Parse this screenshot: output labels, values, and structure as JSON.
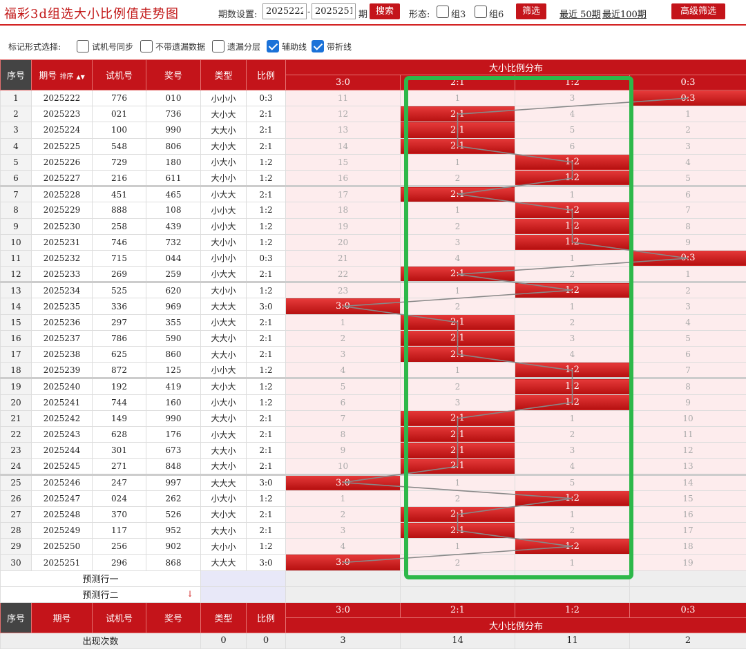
{
  "toolbar": {
    "title": "福彩3d组选大小比例值走势图",
    "period_label": "期数设置:",
    "from": "2025222",
    "dash": "-",
    "to": "2025251",
    "period_unit": "期",
    "search": "搜索",
    "form_label": "形态:",
    "zu3": "组3",
    "zu6": "组6",
    "filter": "筛选",
    "recent50": "最近 50期",
    "recent100": "最近100期",
    "advanced": "高级筛选"
  },
  "options": {
    "label": "标记形式选择:",
    "items": [
      {
        "label": "试机号同步",
        "checked": false
      },
      {
        "label": "不带遗漏数据",
        "checked": false
      },
      {
        "label": "遗漏分层",
        "checked": false
      },
      {
        "label": "辅助线",
        "checked": true
      },
      {
        "label": "带折线",
        "checked": true
      }
    ]
  },
  "header": {
    "seq": "序号",
    "issue": "期号",
    "sort": "排序",
    "test": "试机号",
    "prize": "奖号",
    "type": "类型",
    "ratio": "比例",
    "dist": "大小比例分布",
    "cols": [
      "3:0",
      "2:1",
      "1:2",
      "0:3"
    ]
  },
  "rows": [
    {
      "seq": "1",
      "issue": "2025222",
      "test": "776",
      "prize": "010",
      "type": "小小小",
      "ratio": "0:3",
      "hit": 3,
      "m": [
        "11",
        "1",
        "3",
        "0:3"
      ]
    },
    {
      "seq": "2",
      "issue": "2025223",
      "test": "021",
      "prize": "736",
      "type": "大小大",
      "ratio": "2:1",
      "hit": 1,
      "m": [
        "12",
        "2:1",
        "4",
        "1"
      ]
    },
    {
      "seq": "3",
      "issue": "2025224",
      "test": "100",
      "prize": "990",
      "type": "大大小",
      "ratio": "2:1",
      "hit": 1,
      "m": [
        "13",
        "2:1",
        "5",
        "2"
      ]
    },
    {
      "seq": "4",
      "issue": "2025225",
      "test": "548",
      "prize": "806",
      "type": "大小大",
      "ratio": "2:1",
      "hit": 1,
      "m": [
        "14",
        "2:1",
        "6",
        "3"
      ]
    },
    {
      "seq": "5",
      "issue": "2025226",
      "test": "729",
      "prize": "180",
      "type": "小大小",
      "ratio": "1:2",
      "hit": 2,
      "m": [
        "15",
        "1",
        "1:2",
        "4"
      ]
    },
    {
      "seq": "6",
      "issue": "2025227",
      "test": "216",
      "prize": "611",
      "type": "大小小",
      "ratio": "1:2",
      "hit": 2,
      "m": [
        "16",
        "2",
        "1:2",
        "5"
      ]
    },
    {
      "seq": "7",
      "issue": "2025228",
      "test": "451",
      "prize": "465",
      "type": "小大大",
      "ratio": "2:1",
      "hit": 1,
      "m": [
        "17",
        "2:1",
        "1",
        "6"
      ]
    },
    {
      "seq": "8",
      "issue": "2025229",
      "test": "888",
      "prize": "108",
      "type": "小小大",
      "ratio": "1:2",
      "hit": 2,
      "m": [
        "18",
        "1",
        "1:2",
        "7"
      ]
    },
    {
      "seq": "9",
      "issue": "2025230",
      "test": "258",
      "prize": "439",
      "type": "小小大",
      "ratio": "1:2",
      "hit": 2,
      "m": [
        "19",
        "2",
        "1:2",
        "8"
      ]
    },
    {
      "seq": "10",
      "issue": "2025231",
      "test": "746",
      "prize": "732",
      "type": "大小小",
      "ratio": "1:2",
      "hit": 2,
      "m": [
        "20",
        "3",
        "1:2",
        "9"
      ]
    },
    {
      "seq": "11",
      "issue": "2025232",
      "test": "715",
      "prize": "044",
      "type": "小小小",
      "ratio": "0:3",
      "hit": 3,
      "m": [
        "21",
        "4",
        "1",
        "0:3"
      ]
    },
    {
      "seq": "12",
      "issue": "2025233",
      "test": "269",
      "prize": "259",
      "type": "小大大",
      "ratio": "2:1",
      "hit": 1,
      "m": [
        "22",
        "2:1",
        "2",
        "1"
      ]
    },
    {
      "seq": "13",
      "issue": "2025234",
      "test": "525",
      "prize": "620",
      "type": "大小小",
      "ratio": "1:2",
      "hit": 2,
      "m": [
        "23",
        "1",
        "1:2",
        "2"
      ]
    },
    {
      "seq": "14",
      "issue": "2025235",
      "test": "336",
      "prize": "969",
      "type": "大大大",
      "ratio": "3:0",
      "hit": 0,
      "m": [
        "3:0",
        "2",
        "1",
        "3"
      ]
    },
    {
      "seq": "15",
      "issue": "2025236",
      "test": "297",
      "prize": "355",
      "type": "小大大",
      "ratio": "2:1",
      "hit": 1,
      "m": [
        "1",
        "2:1",
        "2",
        "4"
      ]
    },
    {
      "seq": "16",
      "issue": "2025237",
      "test": "786",
      "prize": "590",
      "type": "大大小",
      "ratio": "2:1",
      "hit": 1,
      "m": [
        "2",
        "2:1",
        "3",
        "5"
      ]
    },
    {
      "seq": "17",
      "issue": "2025238",
      "test": "625",
      "prize": "860",
      "type": "大大小",
      "ratio": "2:1",
      "hit": 1,
      "m": [
        "3",
        "2:1",
        "4",
        "6"
      ]
    },
    {
      "seq": "18",
      "issue": "2025239",
      "test": "872",
      "prize": "125",
      "type": "小小大",
      "ratio": "1:2",
      "hit": 2,
      "m": [
        "4",
        "1",
        "1:2",
        "7"
      ]
    },
    {
      "seq": "19",
      "issue": "2025240",
      "test": "192",
      "prize": "419",
      "type": "大小大",
      "ratio": "1:2",
      "hit": 2,
      "m": [
        "5",
        "2",
        "1:2",
        "8"
      ]
    },
    {
      "seq": "20",
      "issue": "2025241",
      "test": "744",
      "prize": "160",
      "type": "小大小",
      "ratio": "1:2",
      "hit": 2,
      "m": [
        "6",
        "3",
        "1:2",
        "9"
      ]
    },
    {
      "seq": "21",
      "issue": "2025242",
      "test": "149",
      "prize": "990",
      "type": "大大小",
      "ratio": "2:1",
      "hit": 1,
      "m": [
        "7",
        "2:1",
        "1",
        "10"
      ]
    },
    {
      "seq": "22",
      "issue": "2025243",
      "test": "628",
      "prize": "176",
      "type": "小大大",
      "ratio": "2:1",
      "hit": 1,
      "m": [
        "8",
        "2:1",
        "2",
        "11"
      ]
    },
    {
      "seq": "23",
      "issue": "2025244",
      "test": "301",
      "prize": "673",
      "type": "大大小",
      "ratio": "2:1",
      "hit": 1,
      "m": [
        "9",
        "2:1",
        "3",
        "12"
      ]
    },
    {
      "seq": "24",
      "issue": "2025245",
      "test": "271",
      "prize": "848",
      "type": "大大小",
      "ratio": "2:1",
      "hit": 1,
      "m": [
        "10",
        "2:1",
        "4",
        "13"
      ]
    },
    {
      "seq": "25",
      "issue": "2025246",
      "test": "247",
      "prize": "997",
      "type": "大大大",
      "ratio": "3:0",
      "hit": 0,
      "m": [
        "3:0",
        "1",
        "5",
        "14"
      ]
    },
    {
      "seq": "26",
      "issue": "2025247",
      "test": "024",
      "prize": "262",
      "type": "小大小",
      "ratio": "1:2",
      "hit": 2,
      "m": [
        "1",
        "2",
        "1:2",
        "15"
      ]
    },
    {
      "seq": "27",
      "issue": "2025248",
      "test": "370",
      "prize": "526",
      "type": "大小大",
      "ratio": "2:1",
      "hit": 1,
      "m": [
        "2",
        "2:1",
        "1",
        "16"
      ]
    },
    {
      "seq": "28",
      "issue": "2025249",
      "test": "117",
      "prize": "952",
      "type": "大大小",
      "ratio": "2:1",
      "hit": 1,
      "m": [
        "3",
        "2:1",
        "2",
        "17"
      ]
    },
    {
      "seq": "29",
      "issue": "2025250",
      "test": "256",
      "prize": "902",
      "type": "大小小",
      "ratio": "1:2",
      "hit": 2,
      "m": [
        "4",
        "1",
        "1:2",
        "18"
      ]
    },
    {
      "seq": "30",
      "issue": "2025251",
      "test": "296",
      "prize": "868",
      "type": "大大大",
      "ratio": "3:0",
      "hit": 0,
      "m": [
        "3:0",
        "2",
        "1",
        "19"
      ]
    }
  ],
  "predict": [
    "预测行一",
    "预测行二"
  ],
  "footer": {
    "stat_label": "出现次数",
    "type_count": "0",
    "ratio_count": "0",
    "counts": [
      "3",
      "14",
      "11",
      "2"
    ]
  },
  "colors": {
    "accent": "#c4141a",
    "highlight": "#2db84a"
  }
}
